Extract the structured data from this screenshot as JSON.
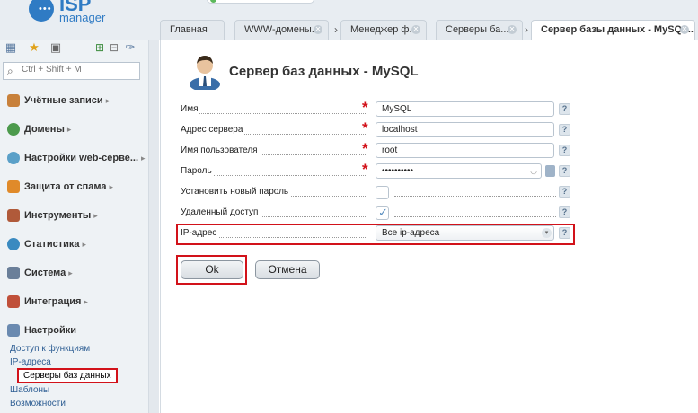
{
  "header": {
    "logo_text": "ISP",
    "logo_sub": "manager"
  },
  "tabs": [
    {
      "label": "Главная"
    },
    {
      "label": "WWW-домены..."
    },
    {
      "label": "Менеджер ф..."
    },
    {
      "label": "Серверы ба..."
    },
    {
      "label": "Сервер базы данных - MySQL..."
    }
  ],
  "sidebar": {
    "search_placeholder": "Ctrl + Shift + M",
    "items": [
      {
        "label": "Учётные записи",
        "icon": "users-icon"
      },
      {
        "label": "Домены",
        "icon": "globe-icon"
      },
      {
        "label": "Настройки web-серве...",
        "icon": "web-settings-icon"
      },
      {
        "label": "Защита от спама",
        "icon": "shield-icon"
      },
      {
        "label": "Инструменты",
        "icon": "tools-icon"
      },
      {
        "label": "Статистика",
        "icon": "stats-icon"
      },
      {
        "label": "Система",
        "icon": "system-icon"
      },
      {
        "label": "Интеграция",
        "icon": "integration-icon"
      },
      {
        "label": "Настройки",
        "icon": "settings-icon"
      }
    ],
    "subitems": [
      {
        "label": "Доступ к функциям"
      },
      {
        "label": "IP-адреса"
      },
      {
        "label": "Серверы баз данных"
      },
      {
        "label": "Шаблоны"
      },
      {
        "label": "Возможности"
      }
    ]
  },
  "form": {
    "title": "Сервер баз данных - MySQL",
    "fields": {
      "name": {
        "label": "Имя",
        "value": "MySQL"
      },
      "server_address": {
        "label": "Адрес сервера",
        "value": "localhost"
      },
      "username": {
        "label": "Имя пользователя",
        "value": "root"
      },
      "password": {
        "label": "Пароль",
        "value": "••••••••••"
      },
      "set_new_password": {
        "label": "Установить новый пароль",
        "checked": false
      },
      "remote_access": {
        "label": "Удаленный доступ",
        "checked": true
      },
      "ip_address": {
        "label": "IP-адрес",
        "value": "Все ip-адреса"
      }
    },
    "help_label": "?",
    "required_mark": "*",
    "ok_label": "Ok",
    "cancel_label": "Отмена"
  },
  "colors": {
    "highlight": "#d2121a",
    "accent": "#2f7bc4"
  }
}
